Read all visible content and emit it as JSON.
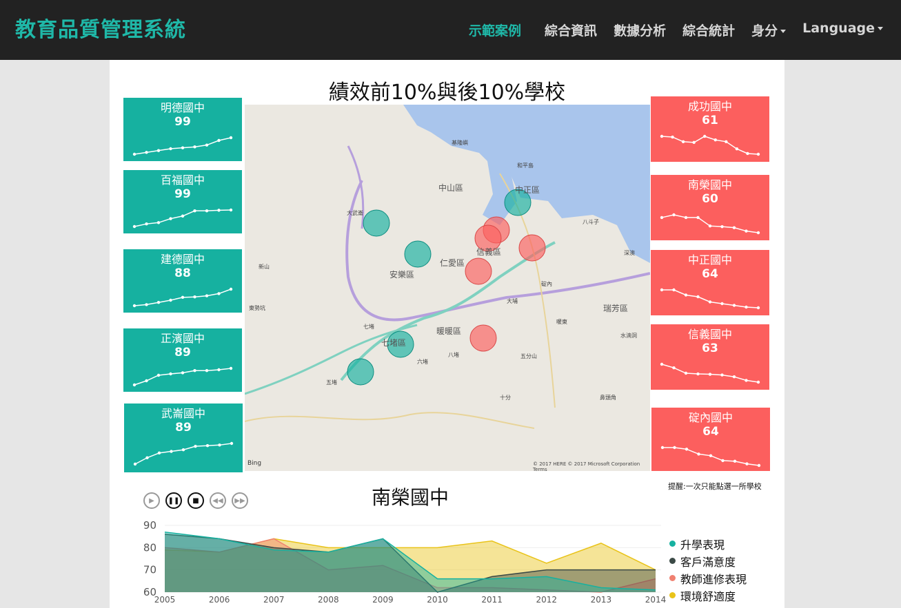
{
  "brand": "教育品質管理系統",
  "nav": {
    "demo": "示範案例",
    "info": "綜合資訊",
    "analysis": "數據分析",
    "stats": "綜合統計",
    "identity": "身分",
    "language": "Language"
  },
  "map_title": "績效前10%與後10%學校",
  "top_schools": [
    {
      "name": "明德國中",
      "score": "99",
      "trend": [
        2,
        3,
        4,
        5,
        5.5,
        6,
        7,
        9.5,
        11
      ]
    },
    {
      "name": "百福國中",
      "score": "99",
      "trend": [
        1,
        2,
        2.5,
        4,
        5,
        7,
        7,
        7.2,
        7.3
      ]
    },
    {
      "name": "建德國中",
      "score": "88",
      "trend": [
        1,
        1.5,
        2.5,
        3.5,
        4.8,
        5,
        5.5,
        6.5,
        8.5
      ]
    },
    {
      "name": "正濱國中",
      "score": "89",
      "trend": [
        1,
        2.5,
        4.5,
        5,
        5.4,
        6.2,
        6.2,
        6.5,
        7
      ]
    },
    {
      "name": "武崙國中",
      "score": "89",
      "trend": [
        1,
        3,
        4.5,
        5,
        5.5,
        6.6,
        6.8,
        7,
        7.5
      ]
    }
  ],
  "bottom_schools": [
    {
      "name": "成功國中",
      "score": "61",
      "trend": [
        7,
        6.8,
        5.5,
        5.3,
        7,
        6,
        5.5,
        3.5,
        2.2,
        2
      ]
    },
    {
      "name": "南榮國中",
      "score": "60",
      "trend": [
        6,
        6.8,
        6,
        6,
        3.5,
        3.3,
        3,
        2,
        1.5
      ]
    },
    {
      "name": "中正國中",
      "score": "64",
      "trend": [
        7,
        7,
        5.5,
        5,
        3.5,
        3,
        2.5,
        2,
        1.8
      ]
    },
    {
      "name": "信義國中",
      "score": "63",
      "trend": [
        8,
        7,
        5.5,
        5.3,
        5.2,
        5,
        4.5,
        3.5,
        3
      ]
    },
    {
      "name": "碇內國中",
      "score": "64",
      "trend": [
        7,
        7,
        6.5,
        5,
        4.5,
        3,
        2.8,
        2,
        1.5
      ]
    }
  ],
  "map_labels": {
    "zhongshan": "中山區",
    "zhongzheng": "中正區",
    "xinyi": "信義區",
    "renai": "仁愛區",
    "anle": "安樂區",
    "qidu": "七堵區",
    "nuannuan": "暖暖區",
    "ruifang": "瑞芳區",
    "bing": "Bing",
    "copyright": "© 2017 HERE © 2017 Microsoft Corporation Terms"
  },
  "map_small_labels": [
    "和平島",
    "八斗子",
    "基隆嶼",
    "大武崙",
    "新山",
    "七堵",
    "五堵",
    "六堵",
    "八堵",
    "東勢坑",
    "大埔",
    "十分",
    "深澳",
    "碇內",
    "暖東",
    "五分山",
    "水湳洞",
    "鼻頭角"
  ],
  "selected_school": "南榮國中",
  "hint": "提醒:一次只能點選一所學校",
  "colors": {
    "teal": "#16b1a0",
    "red": "#fc5f5e",
    "yellow": "#e9c319",
    "dark": "#3b4a46",
    "salmon": "#f08070",
    "navbar": "#222222"
  },
  "chart_data": {
    "type": "area",
    "title": "南榮國中",
    "x": [
      "2005",
      "2006",
      "2007",
      "2008",
      "2009",
      "2010",
      "2011",
      "2012",
      "2013",
      "2014"
    ],
    "ylim": [
      60,
      90
    ],
    "yticks": [
      "60",
      "70",
      "80",
      "90"
    ],
    "series": [
      {
        "name": "升學表現",
        "color": "#16b1a0",
        "values": [
          87,
          84,
          79,
          78,
          84,
          66,
          66,
          67,
          62,
          61
        ]
      },
      {
        "name": "客戶滿意度",
        "color": "#3b4a46",
        "values": [
          86,
          84,
          80,
          78,
          84,
          60,
          67,
          70,
          70,
          70
        ]
      },
      {
        "name": "教師進修表現",
        "color": "#f08070",
        "values": [
          80,
          78,
          84,
          70,
          72,
          62,
          62,
          61,
          60,
          66
        ]
      },
      {
        "name": "環境舒適度",
        "color": "#e9c319",
        "values": [
          79,
          78,
          84,
          80,
          80,
          80,
          83,
          73,
          82,
          70
        ]
      }
    ]
  }
}
